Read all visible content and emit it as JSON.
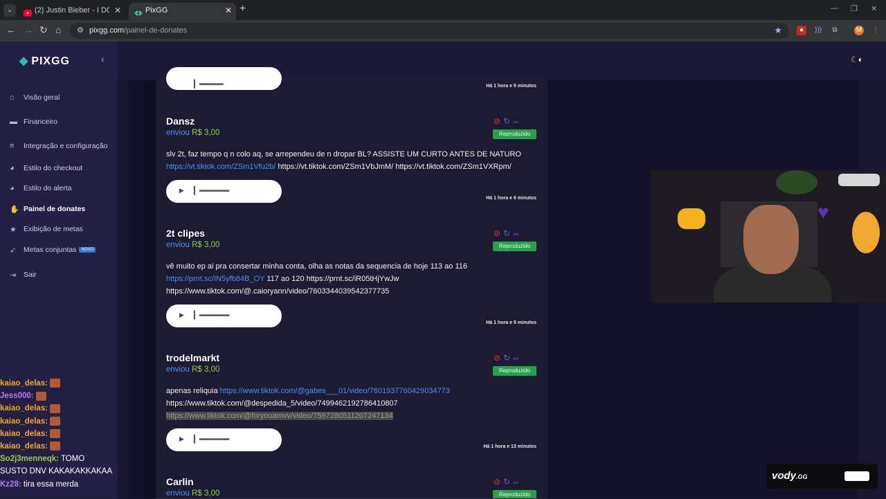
{
  "browser": {
    "tabs": [
      {
        "title": "(2) Justin Bieber - I DO (Audio)",
        "icon": "youtube-icon",
        "close": "✕"
      },
      {
        "title": "PixGG",
        "icon": "pixgg-icon",
        "close": "✕"
      }
    ],
    "new_tab": "+",
    "url_domain": "pixgg.com",
    "url_path": "/painel-de-donates",
    "profile_initial": "M"
  },
  "sidebar": {
    "logo": "PIXGG",
    "items": [
      {
        "label": "Visão geral",
        "icon": "home-icon"
      },
      {
        "label": "Financeiro",
        "icon": "wallet-icon"
      },
      {
        "label": "Integração e configuração",
        "icon": "settings-icon"
      },
      {
        "label": "Estilo do checkout",
        "icon": "palette-icon"
      },
      {
        "label": "Estilo do alerta",
        "icon": "palette-icon"
      },
      {
        "label": "Painel de donates",
        "icon": "donate-icon"
      },
      {
        "label": "Exibição de metas",
        "icon": "star-icon"
      },
      {
        "label": "Metas conjuntas",
        "icon": "rocket-icon",
        "badge": "NOVO"
      },
      {
        "label": "Sair",
        "icon": "logout-icon"
      }
    ]
  },
  "donations": [
    {
      "time": "Há 1 hora e 5 minutos"
    },
    {
      "name": "Dansz",
      "sent": "enviou",
      "amount": "R$ 3,00",
      "status": "Reproduzido",
      "message": [
        "slv 2t, faz tempo q n colo aq, se arrependeu de n dropar BL? ASSISTE UM CURTO ANTES DE NATURO"
      ],
      "link": "https://vt.tiktok.com/ZSm1Vfu2b/",
      "after_link": " https://vt.tiktok.com/ZSm1VbJmM/ https://vt.tiktok.com/ZSm1VXRpm/",
      "time": "Há 1 hora e 6 minutos"
    },
    {
      "name": "2t clipes",
      "sent": "enviou",
      "amount": "R$ 3,00",
      "status": "Reproduzido",
      "message": [
        "vê muito ep ai pra consertar minha conta, olha as notas da sequencia de hoje 113 ao 116"
      ],
      "link": "https://prnt.sc/IN5yfb84B_OY",
      "after_link": " 117 ao 120 https://prnt.sc/iR05tHjYwJw",
      "line3": "https://www.tiktok.com/@.caioryann/video/7603344039542377735",
      "time": "Há 1 hora e 9 minutos"
    },
    {
      "name": "trodelmarkt",
      "sent": "enviou",
      "amount": "R$ 3,00",
      "status": "Reproduzido",
      "prefix": "apenas reliquia ",
      "link": "https://www.tiktok.com/@gabes___01/video/7601937760429034773",
      "line2": "https://www.tiktok.com/@despedida_5/video/7499462192786410807",
      "line3_selected": "https://www.tiktok.com/@foryouamvv/video/7597280511207247134",
      "time": "Há 1 hora e 13 minutos"
    },
    {
      "name": "Carlin",
      "sent": "enviou",
      "amount": "R$ 3,00",
      "status": "Reproduzido"
    }
  ],
  "chat": [
    {
      "user": "kaiao_delas:",
      "color": "#f5a623",
      "text": ""
    },
    {
      "user": "Jess000:",
      "color": "#b57cf0",
      "text": ""
    },
    {
      "user": "kaiao_delas:",
      "color": "#f5a623",
      "text": ""
    },
    {
      "user": "kaiao_delas:",
      "color": "#f5a623",
      "text": ""
    },
    {
      "user": "kaiao_delas:",
      "color": "#f5a623",
      "text": ""
    },
    {
      "user": "kaiao_delas:",
      "color": "#f5a623",
      "text": ""
    },
    {
      "user": "So2j3menneqk:",
      "color": "#8fd14f",
      "text": " TOMO"
    },
    {
      "user": "",
      "color": "#ffffff",
      "text": "SUSTO DNV KAKAKAKKAKAA"
    },
    {
      "user": "Kz28:",
      "color": "#b57cf0",
      "text": " tira essa merda"
    }
  ],
  "overlay": {
    "brand": "vody",
    "brand_suffix": ".GG"
  }
}
